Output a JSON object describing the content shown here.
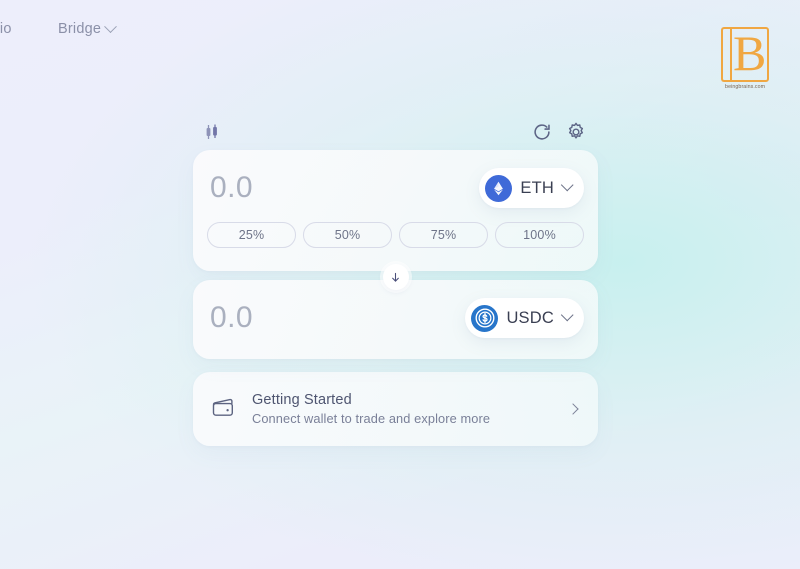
{
  "nav": {
    "items": [
      {
        "label": "folio",
        "has_caret": false
      },
      {
        "label": "Bridge",
        "has_caret": true
      }
    ]
  },
  "watermark": {
    "letter": "B",
    "caption": "beingbrains.com",
    "color": "#f0a742"
  },
  "widget": {
    "toolbar": {
      "chart_icon": "candlestick-chart-icon",
      "refresh_icon": "refresh-icon",
      "settings_icon": "gear-icon"
    },
    "from": {
      "amount_value": "",
      "amount_placeholder": "0.0",
      "token_symbol": "ETH",
      "token_logo": "ethereum-logo",
      "token_color": "#3f6ad8",
      "percent_options": [
        "25%",
        "50%",
        "75%",
        "100%"
      ]
    },
    "swap_direction_icon": "arrow-down-icon",
    "to": {
      "amount_value": "",
      "amount_placeholder": "0.0",
      "token_symbol": "USDC",
      "token_logo": "usdc-logo",
      "token_color": "#2775ca"
    },
    "getting_started": {
      "icon": "wallet-icon",
      "title": "Getting Started",
      "subtitle": "Connect wallet to trade and explore more",
      "chevron": "chevron-right-icon"
    }
  },
  "theme": {
    "bg_lavender": "#eceefb",
    "bg_mint": "#d6f1f0",
    "card_bg": "#fbfbfd",
    "text_primary": "#4e5570",
    "text_muted": "#8b90a8",
    "placeholder": "#aab0bf"
  }
}
